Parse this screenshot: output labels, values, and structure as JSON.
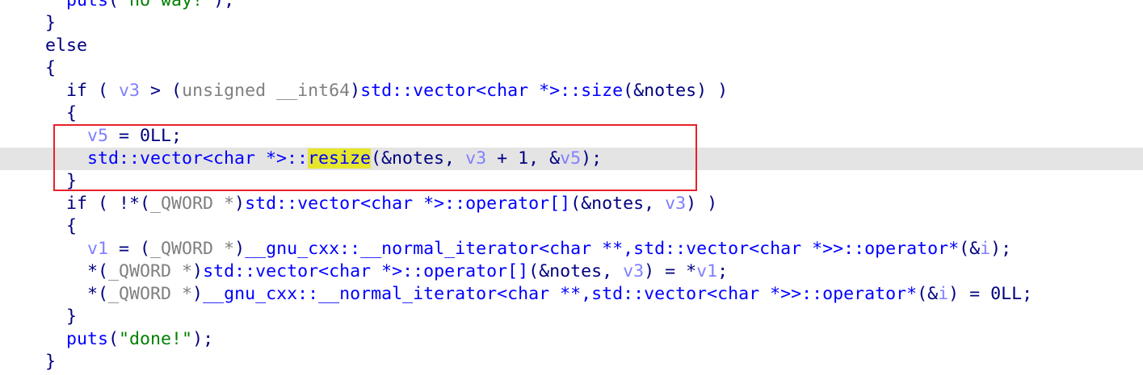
{
  "highlight_color": "#e6e62e",
  "annotation_color": "#e8202a",
  "lines": [
    {
      "indent": 3,
      "tokens": [
        [
          "puts",
          "fn"
        ],
        [
          "(",
          ""
        ],
        [
          "\"no way!\"",
          "str"
        ],
        [
          ");",
          ""
        ]
      ]
    },
    {
      "indent": 2,
      "tokens": [
        [
          "}",
          ""
        ]
      ]
    },
    {
      "indent": 2,
      "tokens": [
        [
          "else",
          ""
        ]
      ]
    },
    {
      "indent": 2,
      "tokens": [
        [
          "{",
          ""
        ]
      ]
    },
    {
      "indent": 3,
      "tokens": [
        [
          "if ( ",
          ""
        ],
        [
          "v3",
          "var"
        ],
        [
          " > (",
          ""
        ],
        [
          "unsigned __int64",
          "type"
        ],
        [
          ")",
          ""
        ],
        [
          "std::vector<char *>::size",
          "fn"
        ],
        [
          "(&notes) )",
          ""
        ]
      ]
    },
    {
      "indent": 3,
      "tokens": [
        [
          "{",
          ""
        ]
      ]
    },
    {
      "indent": 4,
      "tokens": [
        [
          "v5",
          "var"
        ],
        [
          " = 0LL;",
          ""
        ]
      ]
    },
    {
      "indent": 4,
      "current": true,
      "tokens": [
        [
          "std::vector<char *>::",
          "fn"
        ],
        [
          "resize",
          "hl"
        ],
        [
          "(&notes, ",
          ""
        ],
        [
          "v3",
          "var"
        ],
        [
          " + 1, &",
          ""
        ],
        [
          "v5",
          "var"
        ],
        [
          ");",
          ""
        ]
      ]
    },
    {
      "indent": 3,
      "tokens": [
        [
          "}",
          ""
        ]
      ]
    },
    {
      "indent": 3,
      "tokens": [
        [
          "if ( !*(",
          ""
        ],
        [
          "_QWORD *",
          "type"
        ],
        [
          ")",
          ""
        ],
        [
          "std::vector<char *>::operator[]",
          "fn"
        ],
        [
          "(&notes, ",
          ""
        ],
        [
          "v3",
          "var"
        ],
        [
          ") )",
          ""
        ]
      ]
    },
    {
      "indent": 3,
      "tokens": [
        [
          "{",
          ""
        ]
      ]
    },
    {
      "indent": 4,
      "tokens": [
        [
          "v1",
          "var"
        ],
        [
          " = (",
          ""
        ],
        [
          "_QWORD *",
          "type"
        ],
        [
          ")",
          ""
        ],
        [
          "__gnu_cxx::__normal_iterator<char **,std::vector<char *>>::operator*",
          "fn"
        ],
        [
          "(&",
          ""
        ],
        [
          "i",
          "var"
        ],
        [
          ");",
          ""
        ]
      ]
    },
    {
      "indent": 4,
      "tokens": [
        [
          "*(",
          ""
        ],
        [
          "_QWORD *",
          "type"
        ],
        [
          ")",
          ""
        ],
        [
          "std::vector<char *>::operator[]",
          "fn"
        ],
        [
          "(&notes, ",
          ""
        ],
        [
          "v3",
          "var"
        ],
        [
          ") = *",
          ""
        ],
        [
          "v1",
          "var"
        ],
        [
          ";",
          ""
        ]
      ]
    },
    {
      "indent": 4,
      "tokens": [
        [
          "*(",
          ""
        ],
        [
          "_QWORD *",
          "type"
        ],
        [
          ")",
          ""
        ],
        [
          "__gnu_cxx::__normal_iterator<char **,std::vector<char *>>::operator*",
          "fn"
        ],
        [
          "(&",
          ""
        ],
        [
          "i",
          "var"
        ],
        [
          ") = 0LL;",
          ""
        ]
      ]
    },
    {
      "indent": 3,
      "tokens": [
        [
          "}",
          ""
        ]
      ]
    },
    {
      "indent": 3,
      "tokens": [
        [
          "puts",
          "fn"
        ],
        [
          "(",
          ""
        ],
        [
          "\"done!\"",
          "str"
        ],
        [
          ");",
          ""
        ]
      ]
    },
    {
      "indent": 2,
      "tokens": [
        [
          "}",
          ""
        ]
      ]
    }
  ]
}
